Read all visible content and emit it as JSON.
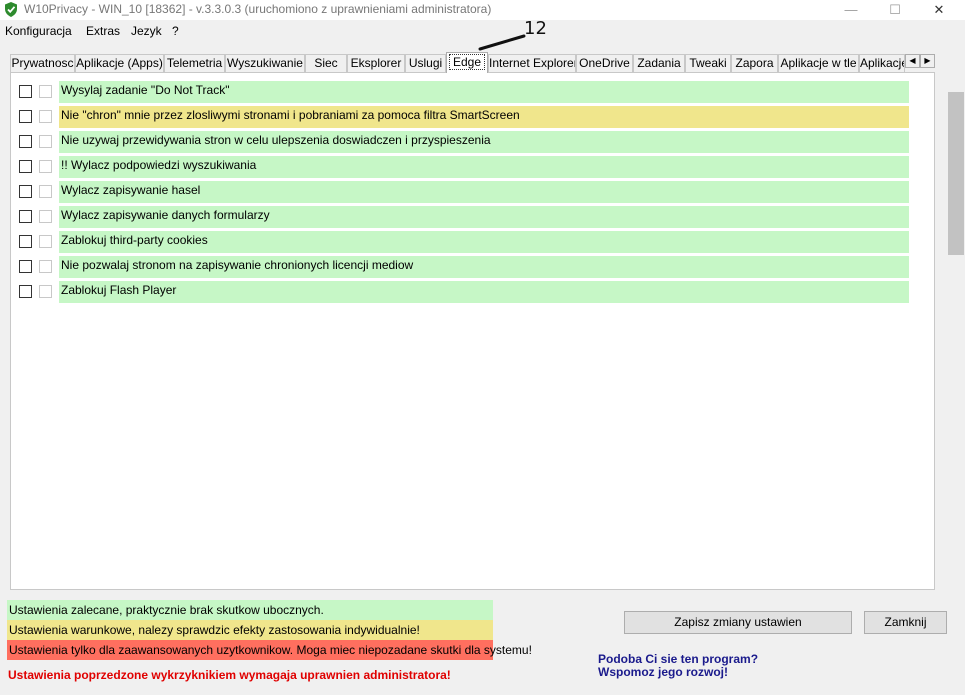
{
  "window": {
    "title": "W10Privacy - WIN_10 [18362]  - v.3.3.0.3 (uruchomiono z uprawnieniami administratora)",
    "controls": {
      "minimize": "—",
      "maximize": "☐",
      "close": "✕"
    }
  },
  "menu": [
    "Konfiguracja",
    "Extras",
    "Jezyk",
    "?"
  ],
  "tabs": [
    "Prywatnosc",
    "Aplikacje (Apps)",
    "Telemetria",
    "Wyszukiwanie",
    "Siec",
    "Eksplorer",
    "Uslugi",
    "Edge",
    "Internet Explorer",
    "OneDrive",
    "Zadania",
    "Tweaki",
    "Zapora",
    "Aplikacje w tle",
    "Aplikacje"
  ],
  "active_tab": "Edge",
  "tab_scroll": {
    "left": "◀",
    "right": "▶"
  },
  "annotation": "12",
  "settings": [
    {
      "label": "Wysylaj zadanie \"Do Not Track\"",
      "level": "green"
    },
    {
      "label": "Nie \"chron\" mnie przez zlosliwymi stronami i pobraniami za pomoca filtra SmartScreen",
      "level": "yellow"
    },
    {
      "label": "Nie uzywaj przewidywania stron w celu ulepszenia doswiadczen i przyspieszenia",
      "level": "green"
    },
    {
      "label": "!! Wylacz podpowiedzi wyszukiwania",
      "level": "green"
    },
    {
      "label": "Wylacz zapisywanie hasel",
      "level": "green"
    },
    {
      "label": "Wylacz zapisywanie danych formularzy",
      "level": "green"
    },
    {
      "label": "Zablokuj third-party cookies",
      "level": "green"
    },
    {
      "label": "Nie pozwalaj stronom na zapisywanie chronionych licencji mediow",
      "level": "green"
    },
    {
      "label": "Zablokuj Flash Player",
      "level": "green"
    }
  ],
  "legend": {
    "green": "Ustawienia zalecane, praktycznie brak skutkow ubocznych.",
    "yellow": "Ustawienia warunkowe, nalezy sprawdzic efekty zastosowania indywidualnie!",
    "red": "Ustawienia tylko dla zaawansowanych uzytkownikow. Moga miec niepozadane skutki dla systemu!"
  },
  "colors": {
    "green": "#c6f7c6",
    "yellow": "#f0e68c",
    "red": "#ff6f5f",
    "warning": "#e00000",
    "promo": "#1a1a8c"
  },
  "warning": "Ustawienia poprzedzone wykrzyknikiem wymagaja uprawnien administratora!",
  "buttons": {
    "save": "Zapisz zmiany ustawien",
    "close": "Zamknij"
  },
  "promo": {
    "line1": "Podoba Ci sie ten program?",
    "line2": "Wspomoz jego rozwoj!"
  }
}
